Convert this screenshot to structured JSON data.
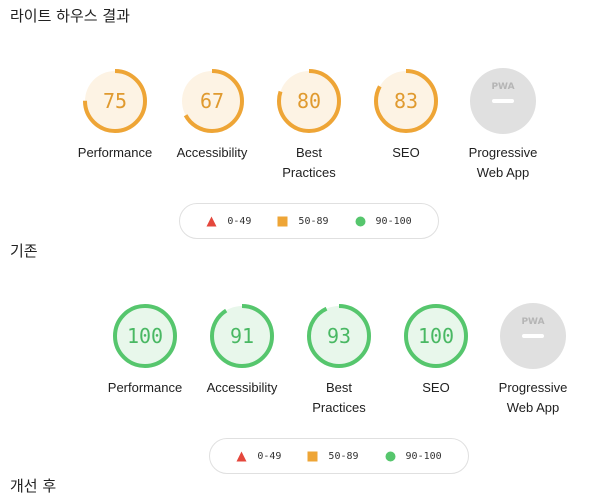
{
  "sections": [
    {
      "heading": "라이트 하우스 결과",
      "gauges": [
        {
          "score": "75",
          "value": 0.75,
          "rating": "average",
          "label": "Performance"
        },
        {
          "score": "67",
          "value": 0.67,
          "rating": "average",
          "label": "Accessibility"
        },
        {
          "score": "80",
          "value": 0.8,
          "rating": "average",
          "label": "Best Practices"
        },
        {
          "score": "83",
          "value": 0.83,
          "rating": "average",
          "label": "SEO"
        },
        {
          "score": "",
          "value": 0,
          "rating": "pwa",
          "label": "Progressive Web App"
        }
      ],
      "legend": [
        {
          "shape": "triangle",
          "range": "0-49"
        },
        {
          "shape": "square",
          "range": "50-89"
        },
        {
          "shape": "circle",
          "range": "90-100"
        }
      ]
    },
    {
      "heading": "기존",
      "gauges": [
        {
          "score": "100",
          "value": 1.0,
          "rating": "pass",
          "label": "Performance"
        },
        {
          "score": "91",
          "value": 0.91,
          "rating": "pass",
          "label": "Accessibility"
        },
        {
          "score": "93",
          "value": 0.93,
          "rating": "pass",
          "label": "Best Practices"
        },
        {
          "score": "100",
          "value": 1.0,
          "rating": "pass",
          "label": "SEO"
        },
        {
          "score": "",
          "value": 0,
          "rating": "pwa",
          "label": "Progressive Web App"
        }
      ],
      "legend": [
        {
          "shape": "triangle",
          "range": "0-49"
        },
        {
          "shape": "square",
          "range": "50-89"
        },
        {
          "shape": "circle",
          "range": "90-100"
        }
      ]
    }
  ],
  "footer_heading": "개선 후",
  "colors": {
    "fail": "#e4473c",
    "average": "#eea536",
    "pass": "#56c66d",
    "average_fill": "#fdf3e4",
    "pass_fill": "#e8f7eb",
    "average_text": "#e09a2f",
    "pass_text": "#49b863",
    "pwa_fill": "#e0e0e0",
    "pwa_mark": "#ffffff",
    "pwa_badge_text": "#b5b5b5"
  },
  "icons": {
    "pwa_badge": "pwa-badge-icon"
  },
  "pwa_badge_text": "PWA"
}
